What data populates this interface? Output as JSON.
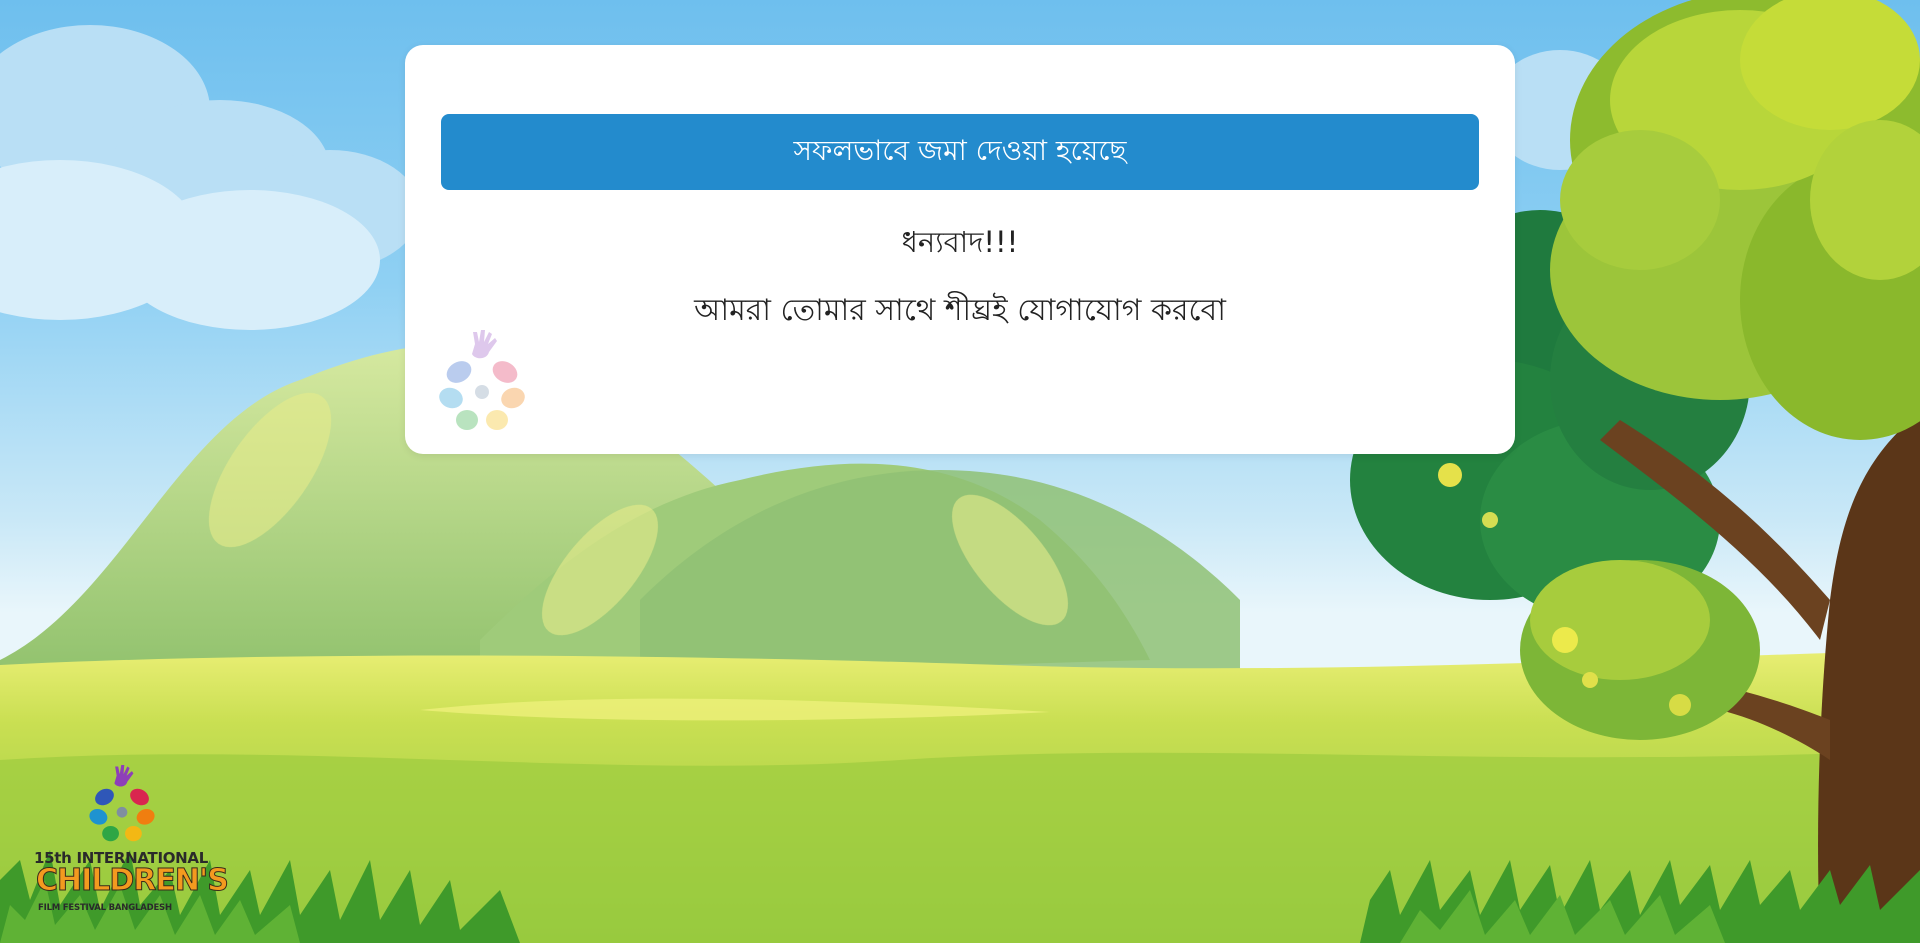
{
  "card": {
    "success_message": "সফলভাবে জমা দেওয়া হয়েছে",
    "thanks_text": "ধন্যবাদ!!!",
    "followup_text": "আমরা তোমার সাথে শীঘ্রই যোগাযোগ করবো"
  },
  "logo": {
    "line1": "15th INTERNATIONAL",
    "line2": "CHILDREN'S",
    "line3": "FILM FESTIVAL BANGLADESH"
  },
  "colors": {
    "banner": "#238bcd",
    "sky": "#6ebfee",
    "grass": "#a9d34a",
    "card": "#ffffff"
  }
}
